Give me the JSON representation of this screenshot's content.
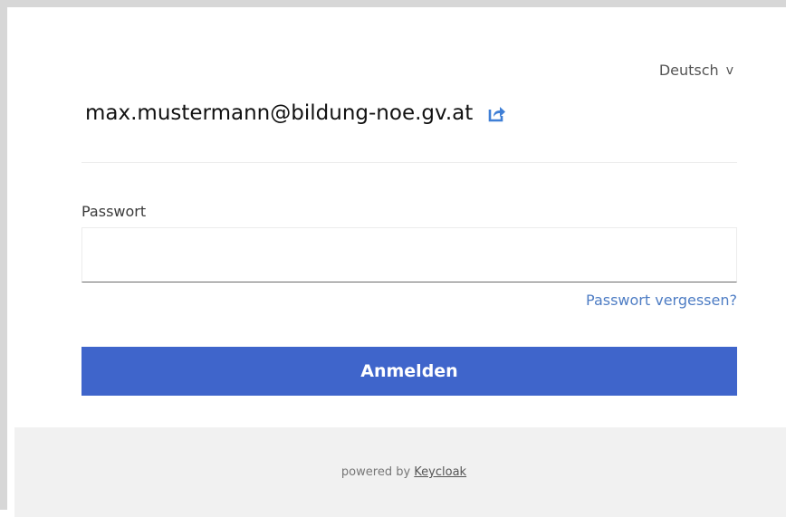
{
  "header": {
    "language": "Deutsch",
    "language_chevron": "v"
  },
  "user": {
    "username": "max.mustermann@bildung-noe.gv.at",
    "reset_icon": "share-arrow-icon"
  },
  "form": {
    "password_label": "Passwort",
    "password_value": "",
    "forgot_link": "Passwort vergessen?",
    "login_button": "Anmelden"
  },
  "footer": {
    "powered_by": "powered by",
    "provider": "Keycloak"
  },
  "colors": {
    "primary": "#3f65cb",
    "link": "#4e7dc4",
    "footer_bg": "#f1f1f1"
  }
}
